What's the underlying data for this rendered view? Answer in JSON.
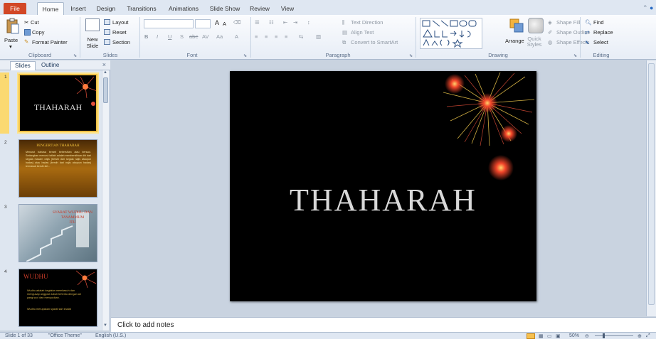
{
  "tabs": [
    "File",
    "Home",
    "Insert",
    "Design",
    "Transitions",
    "Animations",
    "Slide Show",
    "Review",
    "View"
  ],
  "ribbon": {
    "clipboard": {
      "paste": "Paste",
      "cut": "Cut",
      "copy": "Copy",
      "format_painter": "Format Painter",
      "label": "Clipboard"
    },
    "slides": {
      "new_slide": "New Slide",
      "layout": "Layout",
      "reset": "Reset",
      "section": "Section",
      "label": "Slides"
    },
    "font": {
      "bold": "B",
      "italic": "I",
      "underline": "U",
      "strike": "S",
      "shadow": "abe",
      "spacing": "AV",
      "case": "Aa",
      "color": "A",
      "grow": "A",
      "shrink": "A",
      "label": "Font"
    },
    "paragraph": {
      "text_direction": "Text Direction",
      "align_text": "Align Text",
      "convert_smartart": "Convert to SmartArt",
      "label": "Paragraph"
    },
    "drawing": {
      "arrange": "Arrange",
      "quick_styles": "Quick Styles",
      "shape_fill": "Shape Fill",
      "shape_outline": "Shape Outline",
      "shape_effects": "Shape Effects",
      "label": "Drawing"
    },
    "editing": {
      "find": "Find",
      "replace": "Replace",
      "select": "Select",
      "label": "Editing"
    }
  },
  "panel": {
    "tab_slides": "Slides",
    "tab_outline": "Outline",
    "close": "×",
    "thumbs": [
      {
        "num": "1",
        "title": "THAHARAH"
      },
      {
        "num": "2",
        "title": "PENGERTIAN THAHARAH",
        "body": "Menurut bahasa berarti bebersihan atau bersuci. Sedangkan menurut istilah adalah membersihkan diri dari segala macam najis (bersih dari segala najis ataupun hadas) atau hadas (bersih dari najis ataupun hadas) termasuk bersih diri..."
      },
      {
        "num": "3",
        "title": "SYARAT WUDHU DAN TAYAMMUM",
        "title2": "ITU"
      },
      {
        "num": "4",
        "title": "WUDHU",
        "body": "Wudhu adalah kegiatan membasuh dan mengusap anggota tubuh tertentu dengan air yang suci dan menyucikan.",
        "body2": "Wudhu merupakan syarat sah shalat"
      }
    ]
  },
  "slide": {
    "title": "THAHARAH"
  },
  "notes": {
    "placeholder": "Click to add notes"
  },
  "status": {
    "slide": "Slide 1 of 33",
    "theme": "\"Office Theme\"",
    "language": "English (U.S.)",
    "zoom": "50%"
  }
}
